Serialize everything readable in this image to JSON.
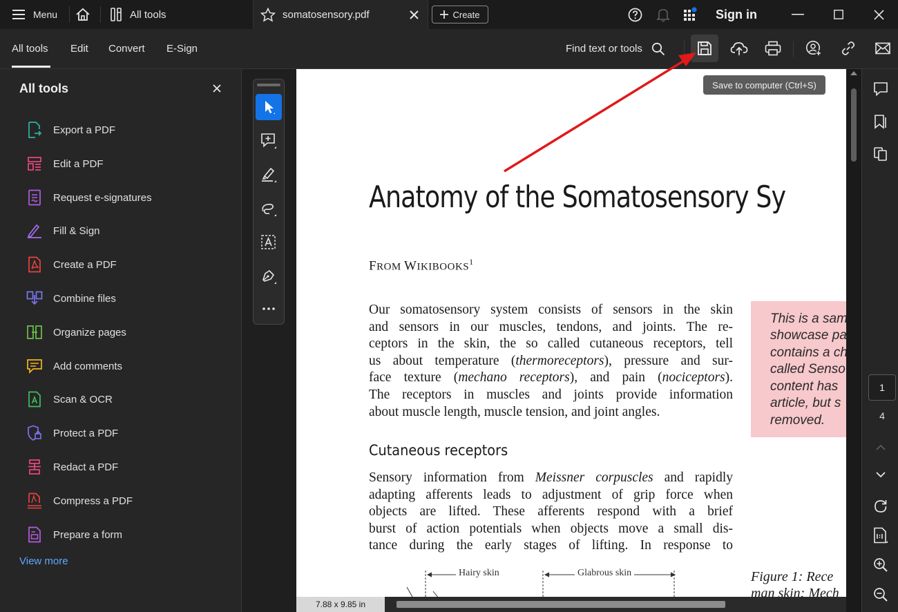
{
  "titlebar": {
    "menu_label": "Menu",
    "all_tools_label": "All tools",
    "tab_filename": "somatosensory.pdf",
    "create_label": "Create",
    "signin_label": "Sign in"
  },
  "toolbar": {
    "tabs": [
      "All tools",
      "Edit",
      "Convert",
      "E-Sign"
    ],
    "find_label": "Find text or tools",
    "save_tooltip": "Save to computer (Ctrl+S)"
  },
  "left_panel": {
    "title": "All tools",
    "items": [
      {
        "label": "Export a PDF",
        "icon": "export-pdf-icon",
        "color": "#2fb3a0"
      },
      {
        "label": "Edit a PDF",
        "icon": "edit-pdf-icon",
        "color": "#e8477f"
      },
      {
        "label": "Request e-signatures",
        "icon": "request-esign-icon",
        "color": "#b35ce0"
      },
      {
        "label": "Fill & Sign",
        "icon": "fill-sign-icon",
        "color": "#a56cf0"
      },
      {
        "label": "Create a PDF",
        "icon": "create-pdf-icon",
        "color": "#e8433f"
      },
      {
        "label": "Combine files",
        "icon": "combine-files-icon",
        "color": "#7b76f2"
      },
      {
        "label": "Organize pages",
        "icon": "organize-pages-icon",
        "color": "#6cc24a"
      },
      {
        "label": "Add comments",
        "icon": "add-comments-icon",
        "color": "#f2b51a"
      },
      {
        "label": "Scan & OCR",
        "icon": "scan-ocr-icon",
        "color": "#3fbf62"
      },
      {
        "label": "Protect a PDF",
        "icon": "protect-pdf-icon",
        "color": "#7d72f0"
      },
      {
        "label": "Redact a PDF",
        "icon": "redact-pdf-icon",
        "color": "#e8477f"
      },
      {
        "label": "Compress a PDF",
        "icon": "compress-pdf-icon",
        "color": "#e8433f"
      },
      {
        "label": "Prepare a form",
        "icon": "prepare-form-icon",
        "color": "#b35ce0"
      }
    ],
    "view_more": "View more"
  },
  "document": {
    "title": "Anatomy of the Somatosensory Sy",
    "from_prefix": "F",
    "from_rest": "ROM ",
    "from_w": "W",
    "from_ikibooks": "IKIBOOKS",
    "footnote": "1",
    "para1": [
      [
        "Our somatosensory system consists of sensors in the skin"
      ],
      [
        "and sensors in our muscles, tendons, and joints. The re-"
      ],
      [
        "ceptors in the skin, the so called cutaneous receptors, tell"
      ],
      [
        "us about temperature (",
        "thermoreceptors",
        "), pressure and sur-"
      ],
      [
        "face texture (",
        "mechano receptors",
        "), and pain (",
        "nociceptors",
        ")."
      ],
      [
        "The receptors in muscles and joints provide information"
      ],
      [
        "about muscle length, muscle tension, and joint angles."
      ]
    ],
    "heading": "Cutaneous receptors",
    "para2": [
      [
        "Sensory information from ",
        "Meissner corpuscles",
        " and rapidly"
      ],
      [
        "adapting afferents leads to adjustment of grip force when"
      ],
      [
        "objects are lifted. These afferents respond with a brief"
      ],
      [
        "burst of action potentials when objects move a small dis-"
      ],
      [
        "tance during the early stages of lifting. In response to"
      ]
    ],
    "sidebar_note": [
      "This is a samp",
      "showcase pa",
      "contains a ch",
      "called Senso",
      "content has",
      "article, but s",
      "removed."
    ],
    "figure_caption_1": "Figure 1:   Rece",
    "figure_caption_2": "man skin: Mech",
    "figure_label_hairy": "Hairy skin",
    "figure_label_glabrous": "Glabrous skin"
  },
  "status": {
    "page_size": "7.88 x 9.85 in",
    "current_page": "1",
    "total_pages": "4"
  },
  "colors": {
    "accent_blue": "#1473e6",
    "annotation_arrow": "#e0191b",
    "pink_note": "#f7c8cc"
  }
}
